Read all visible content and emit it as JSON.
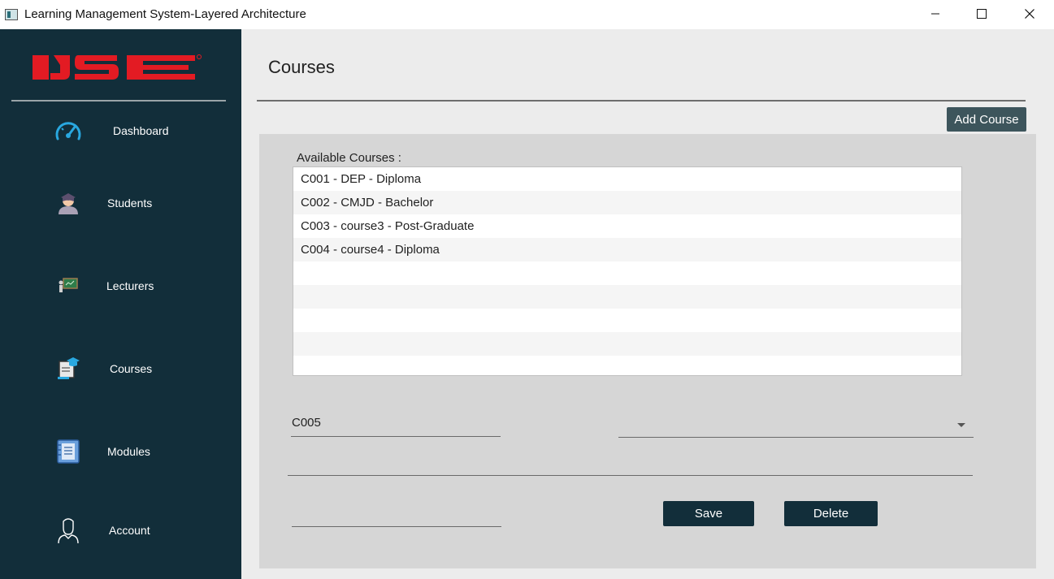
{
  "window": {
    "title": "Learning Management System-Layered Architecture"
  },
  "sidebar": {
    "logo_text": "IJSE",
    "logo_color": "#e31b23",
    "background": "#122e3a",
    "items": [
      {
        "label": "Dashboard",
        "icon": "speedometer-icon"
      },
      {
        "label": "Students",
        "icon": "student-icon"
      },
      {
        "label": "Lecturers",
        "icon": "lecturer-board-icon"
      },
      {
        "label": "Courses",
        "icon": "course-graduation-icon"
      },
      {
        "label": "Modules",
        "icon": "notebook-icon"
      },
      {
        "label": "Account",
        "icon": "user-account-icon"
      }
    ]
  },
  "main": {
    "title": "Courses",
    "add_button": "Add Course",
    "list_label": "Available Courses :",
    "courses": [
      "C001 - DEP - Diploma",
      "C002 - CMJD - Bachelor",
      "C003 - course3 - Post-Graduate",
      "C004 - course4 - Diploma",
      "",
      "",
      "",
      "",
      ""
    ],
    "form": {
      "course_id_value": "C005",
      "course_type_value": "",
      "course_name_value": "",
      "course_fee_value": ""
    },
    "save_button": "Save",
    "delete_button": "Delete"
  }
}
